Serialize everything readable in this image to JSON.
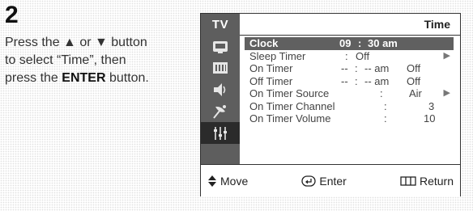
{
  "step": {
    "number": "2"
  },
  "instruction": {
    "line1": "Press the ▲ or ▼ button",
    "line2": "to select “Time”, then",
    "line3_prefix": "press the ",
    "line3_bold": "ENTER",
    "line3_suffix": " button."
  },
  "tv_menu": {
    "sidebar_label": "TV",
    "icons": [
      "picture-icon",
      "sound-icon",
      "speaker-icon",
      "antenna-icon",
      "setup-icon"
    ],
    "active_icon": "setup-icon",
    "title": "Time",
    "rows": [
      {
        "label": "Clock",
        "v1": "09",
        "sep": ":",
        "v2": "30 am",
        "arrow": "",
        "selected": true
      },
      {
        "label": "Sleep Timer",
        "v1": "",
        "sep": ":",
        "v2": "Off",
        "arrow": "▶",
        "selected": false
      },
      {
        "label": "On Timer",
        "v1": "--",
        "sep": ":",
        "v2": "-- am",
        "v3": "Off",
        "arrow": "",
        "selected": false
      },
      {
        "label": "Off Timer",
        "v1": "--",
        "sep": ":",
        "v2": "-- am",
        "v3": "Off",
        "arrow": "",
        "selected": false
      },
      {
        "label": "On Timer Source",
        "v1": "",
        "sep": ":",
        "v2": "Air",
        "arrow": "▶",
        "selected": false
      },
      {
        "label": "On Timer Channel",
        "v1": "",
        "sep": ":",
        "v2": "3",
        "arrow": "",
        "selected": false
      },
      {
        "label": "On Timer Volume",
        "v1": "",
        "sep": ":",
        "v2": "10",
        "arrow": "",
        "selected": false
      }
    ],
    "footer": {
      "move_label": "Move",
      "enter_label": "Enter",
      "return_label": "Return"
    }
  }
}
